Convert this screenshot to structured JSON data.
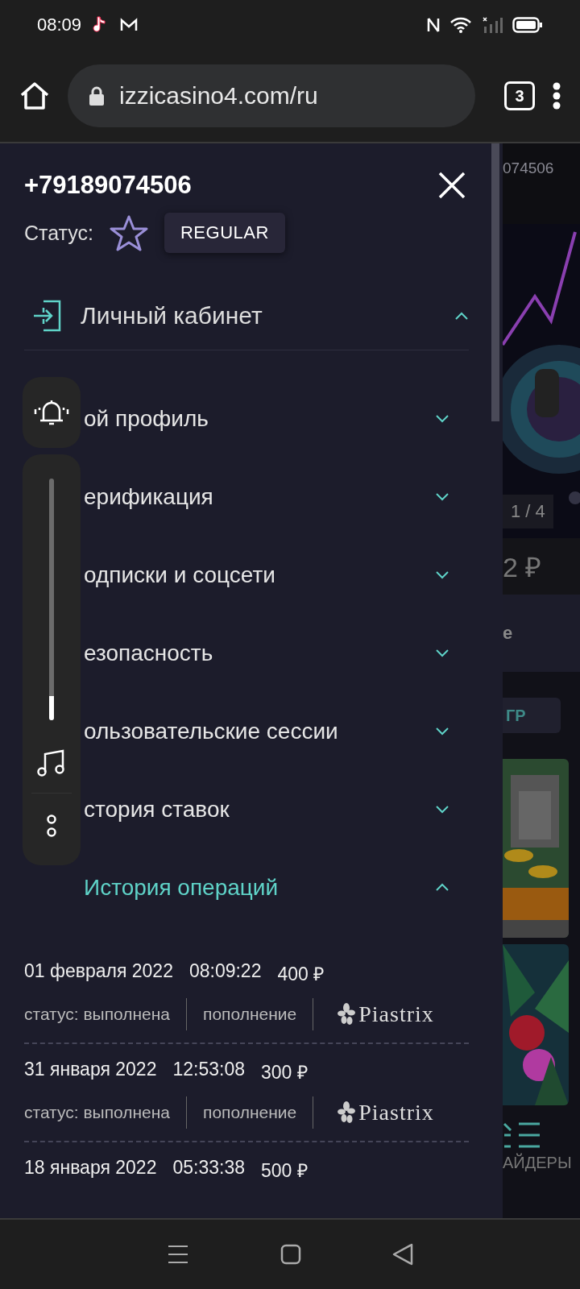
{
  "status_bar": {
    "time": "08:09"
  },
  "browser": {
    "url": "izzicasino4.com/ru",
    "tab_count": "3"
  },
  "drawer": {
    "phone": "+79189074506",
    "status_label": "Статус:",
    "status_badge": "REGULAR",
    "section": {
      "title": "Личный кабинет",
      "expanded": true
    },
    "items": [
      {
        "label": "ой профиль",
        "expanded": false
      },
      {
        "label": "ерификация",
        "expanded": false
      },
      {
        "label": "одписки и соцсети",
        "expanded": false
      },
      {
        "label": "езопасность",
        "expanded": false
      },
      {
        "label": "ользовательские сессии",
        "expanded": false
      },
      {
        "label": "стория ставок",
        "expanded": false
      },
      {
        "label": "История операций",
        "expanded": true
      }
    ],
    "operations": [
      {
        "date": "01 февраля 2022",
        "time": "08:09:22",
        "amount": "400 ₽",
        "status": "статус: выполнена",
        "type": "пополнение",
        "provider": "Piastrix"
      },
      {
        "date": "31 января 2022",
        "time": "12:53:08",
        "amount": "300 ₽",
        "status": "статус: выполнена",
        "type": "пополнение",
        "provider": "Piastrix"
      },
      {
        "date": "18 января 2022",
        "time": "05:33:38",
        "amount": "500 ₽"
      }
    ]
  },
  "volume_panel": {
    "level": 0.1
  },
  "background_page": {
    "account": "074506",
    "slide_counter": "1 / 4",
    "balance": "2 ₽",
    "tab": "е",
    "games_button": "ГР",
    "menu_label": "АЙДЕРЫ"
  }
}
